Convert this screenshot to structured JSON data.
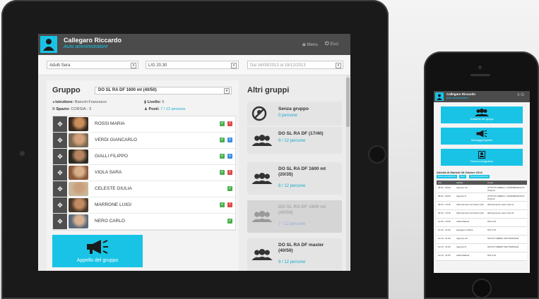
{
  "app": {
    "user_name": "Callegaro Riccardo",
    "user_role": "Auto amministratore",
    "menu_label": "Menu",
    "exit_label": "Esci"
  },
  "filters": {
    "course": "Adulti Sera",
    "schedule": "L/G 20.30",
    "period": "Dal 16/09/2013 al 19/12/2013"
  },
  "group": {
    "title": "Gruppo",
    "selected": "DO SL RA DF 1600 mt (40/50)",
    "instructor_label": "Istruttore:",
    "instructor": "Bianchi Francesco",
    "level_label": "Livello:",
    "level": "5",
    "space_label": "Spazio:",
    "space": "CORSIA - 3",
    "places_label": "Posti:",
    "places": "7 / 12 persone",
    "members": [
      {
        "name": "ROSSI MARIA",
        "badges": [
          "green",
          "red"
        ]
      },
      {
        "name": "VERDI GIANCARLO",
        "badges": [
          "green",
          "blue"
        ]
      },
      {
        "name": "GIALLI FILIPPO",
        "badges": [
          "green",
          "blue"
        ]
      },
      {
        "name": "VIOLA SARA",
        "badges": [
          "green",
          "red"
        ]
      },
      {
        "name": "CELESTE GIULIA",
        "badges": [
          "green"
        ]
      },
      {
        "name": "MARRONE LUIGI",
        "badges": [
          "green",
          "red"
        ]
      },
      {
        "name": "NERO CARLO",
        "badges": [
          "green"
        ]
      }
    ],
    "call_button": "Appello del gruppo"
  },
  "other_groups": {
    "title": "Altri gruppi",
    "cards": [
      {
        "title": "Senza gruppo",
        "sub": "0 persone",
        "icon": "no-group-icon"
      },
      {
        "title": "DO SL RA DF (17/40)",
        "sub": "9 / 12 persone",
        "icon": "people-icon"
      },
      {
        "title": "DO SL RA DF 1600 mt (20/35)",
        "sub": "8 / 12 persone",
        "icon": "people-icon"
      },
      {
        "title": "DO SL RA DF 1600 mt (40/50)",
        "sub": "7 / 12 persone",
        "icon": "people-icon"
      },
      {
        "title": "DO SL RA DF master (40/50)",
        "sub": "9 / 12 persone",
        "icon": "people-icon"
      }
    ]
  },
  "phone": {
    "user_name": "Callegaro Riccardo",
    "buttons": [
      "Gestione dei gruppi",
      "Messaggi/Appello",
      "Ricerca anagrafica"
    ],
    "activity_title": "Attività di Martedì 08 Ottobre 2013",
    "chips": [
      "Nuova prenotazione",
      "Mesi",
      "Nuova prenotazione"
    ],
    "table_headers": [
      "Ora",
      "Attività",
      "Corso"
    ],
    "rows": [
      {
        "time": "08:00 - 09:00",
        "activity": "Ingresso 10",
        "course": "ATTIVITÀ LIBERA / COMPRENSIVA DI ACQUA"
      },
      {
        "time": "08:00 - 09:00",
        "activity": "Ingresso 5",
        "course": "ATTIVITÀ LIBERA / COMPRENSIVA DI ACQUA"
      },
      {
        "time": "09:15 - 10:15",
        "activity": "Abbonamento 12 Nuoto Club",
        "course": "abbonamento nuoto club 12"
      },
      {
        "time": "09:15 - 10:15",
        "activity": "Abbonamento 24 Nuoto Club",
        "course": "abbonamento nuoto club 24"
      },
      {
        "time": "10:00 - 10:45",
        "activity": "Adulti Mattina",
        "course": "M/V 9.15"
      },
      {
        "time": "10:15 - 11:00",
        "activity": "Aquagym mattina",
        "course": "M/V 9.15"
      },
      {
        "time": "10:15 - 11:00",
        "activity": "Ingresso 10",
        "course": "NUOTO LIBERO SETTIMANALE"
      },
      {
        "time": "10:15 - 11:00",
        "activity": "Ingresso 5",
        "course": "NUOTO LIBERO SETTIMANALE"
      },
      {
        "time": "10:15 - 11:00",
        "activity": "Adulti Mattina",
        "course": "M/V 9.15"
      }
    ]
  },
  "colors": {
    "accent": "#19c3e6",
    "topbar": "#4b4b4b",
    "badge_green": "#4caf50",
    "badge_red": "#e04848",
    "badge_blue": "#3a8ee6"
  }
}
